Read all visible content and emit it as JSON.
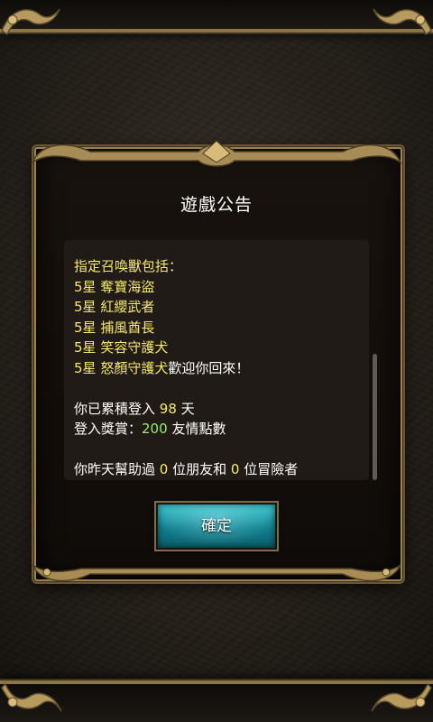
{
  "colors": {
    "highlight_yellow": "#f6e96b",
    "highlight_green": "#9fea67",
    "gold_frame": "#9b8250",
    "button_teal": "#1aa3b1"
  },
  "dialog": {
    "title": "遊戲公告",
    "confirm_label": "確定",
    "announcement": {
      "heading": "指定召喚獸包括：",
      "summons": [
        {
          "stars": "5星",
          "name": "奪寶海盜"
        },
        {
          "stars": "5星",
          "name": "紅纓武者"
        },
        {
          "stars": "5星",
          "name": "捕風酋長"
        },
        {
          "stars": "5星",
          "name": "笑容守護犬"
        },
        {
          "stars": "5星",
          "name": "怒顏守護犬"
        }
      ],
      "welcome_back": "歡迎你回來！"
    },
    "login": {
      "prefix": "你已累積登入",
      "days": "98",
      "suffix": "天"
    },
    "reward": {
      "prefix": "登入獎賞：",
      "amount": "200",
      "suffix": "友情點數"
    },
    "helped": {
      "prefix": "你昨天幫助過",
      "friends": "0",
      "middle": "位朋友和",
      "adventurers": "0",
      "suffix": "位冒險者"
    }
  }
}
